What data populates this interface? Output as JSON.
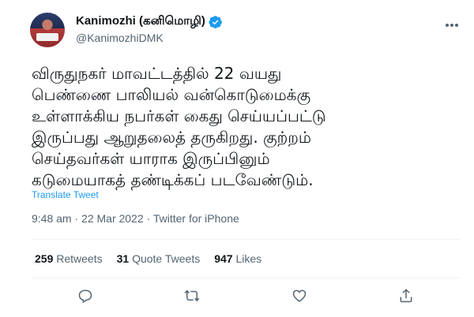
{
  "author": {
    "display_name": "Kanimozhi (கனிமொழி)",
    "handle": "@KanimozhiDMK"
  },
  "tweet": {
    "text": "விருதுநகர் மாவட்டத்தில் 22 வயது\nபெண்ணை பாலியல் வன்கொடுமைக்கு\nஉள்ளாக்கிய நபர்கள் கைது செய்யப்பட்டு\nஇருப்பது ஆறுதலைத் தருகிறது. குற்றம்\nசெய்தவர்கள் யாராக இருப்பினும்\nகடுமையாகத் தண்டிக்கப் படவேண்டும்.",
    "translate_label": "Translate Tweet",
    "meta": "9:48 am · 22 Mar 2022 · Twitter for iPhone"
  },
  "stats": {
    "retweets_count": "259",
    "retweets_label": "Retweets",
    "quotes_count": "31",
    "quotes_label": "Quote Tweets",
    "likes_count": "947",
    "likes_label": "Likes"
  },
  "actions": [
    "reply-icon",
    "retweet-icon",
    "like-icon",
    "share-icon"
  ],
  "colors": {
    "link": "#1d9bf0",
    "muted": "#536471",
    "text": "#0f1419",
    "verified": "#1d9bf0"
  }
}
